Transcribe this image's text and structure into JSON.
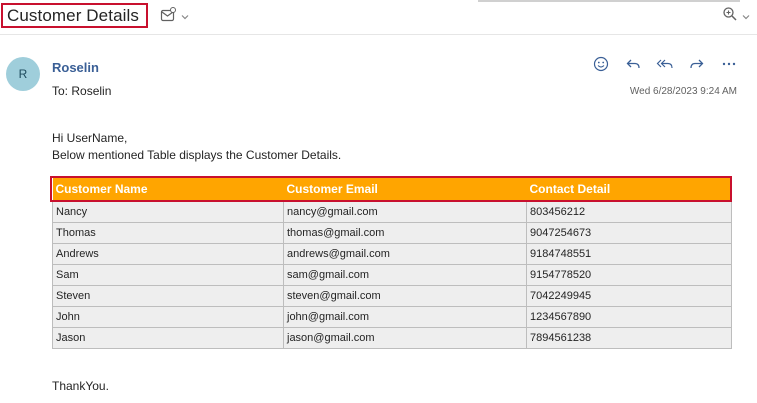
{
  "header": {
    "subject": "Customer Details"
  },
  "sender": {
    "avatar_initial": "R",
    "name": "Roselin",
    "to_label": "To:",
    "to_name": "Roselin",
    "date": "Wed 6/28/2023 9:24 AM"
  },
  "icons": {
    "subject_actions": [
      "mark-read-icon",
      "chevron-down-icon"
    ],
    "zoom": [
      "zoom-icon",
      "chevron-down-icon"
    ],
    "message_actions": [
      "emoji-icon",
      "reply-icon",
      "reply-all-icon",
      "forward-icon",
      "more-icon"
    ]
  },
  "body": {
    "greeting": "Hi UserName,",
    "intro": "Below mentioned Table displays the Customer Details.",
    "closing": "ThankYou."
  },
  "table": {
    "columns": [
      "Customer Name",
      "Customer Email",
      "Contact Detail"
    ],
    "rows": [
      [
        "Nancy",
        "nancy@gmail.com",
        "803456212"
      ],
      [
        "Thomas",
        "thomas@gmail.com",
        "9047254673"
      ],
      [
        "Andrews",
        "andrews@gmail.com",
        "9184748551"
      ],
      [
        "Sam",
        "sam@gmail.com",
        "9154778520"
      ],
      [
        "Steven",
        "steven@gmail.com",
        "7042249945"
      ],
      [
        "John",
        "john@gmail.com",
        "1234567890"
      ],
      [
        "Jason",
        "jason@gmail.com",
        "7894561238"
      ]
    ]
  },
  "colors": {
    "header_fill": "#ffa500",
    "highlight_border": "#c8102e",
    "sender_name": "#3a5f96",
    "avatar_bg": "#9fcedb"
  }
}
